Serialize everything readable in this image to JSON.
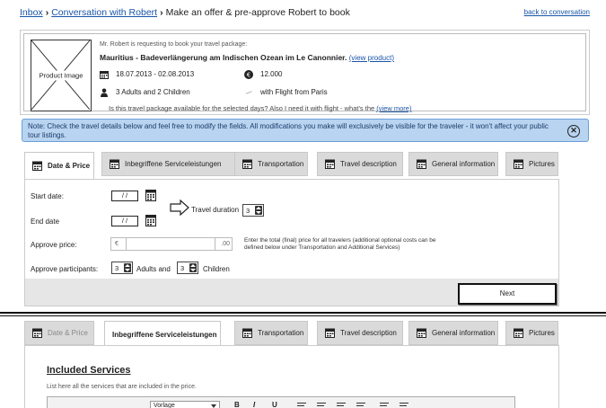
{
  "breadcrumb": {
    "inbox": "Inbox",
    "conversation": "Conversation with Robert",
    "current": "Make an offer & pre-approve Robert to book",
    "separator": "›"
  },
  "back_link": "back to conversation",
  "request": {
    "image_label": "Product Image",
    "intro": "Mr. Robert is requesting to book your travel package:",
    "title": "Mauritius - Badeverlängerung am Indischen Ozean im Le Canonnier.",
    "view_product": "(view product)",
    "dates": "18.07.2013 - 02.08.2013",
    "price": "12.000",
    "guests": "3 Adults and 2 Children",
    "flight": "with Flight from Paris",
    "question": "Is this travel package available for the selected days? Also I need it with flight - what's the",
    "view_more": "(view more)"
  },
  "note": {
    "text": "Note: Check the travel details below and feel free to modify the fields. All modifications you make will exclusively be visible for the traveler - it won't affect your public tour listings."
  },
  "tabs": [
    {
      "label": "Date & Price"
    },
    {
      "label": "Inbegriffene Serviceleistungen"
    },
    {
      "label": "Transportation"
    },
    {
      "label": "Travel description"
    },
    {
      "label": "General information"
    },
    {
      "label": "Pictures"
    }
  ],
  "form": {
    "start_label": "Start date:",
    "end_label": "End date",
    "date_placeholder": "/ /",
    "duration_label": "Travel duration",
    "duration_value": "3",
    "approve_price_label": "Approve price:",
    "currency": "€",
    "decimals": ".00",
    "price_hint": "Enter the total (final) price for all travelers (additional optional costs can be defined below under Transportation and Additional Services)",
    "participants_label": "Approve participants:",
    "adults_value": "3",
    "adults_label": "Adults and",
    "children_value": "3",
    "children_label": "Children",
    "next_button": "Next"
  },
  "included": {
    "title": "Included Services",
    "subtitle": "List here all the services that are included in the price.",
    "style_select": "Vorlage",
    "bold": "B",
    "italic": "I",
    "underline": "U"
  }
}
